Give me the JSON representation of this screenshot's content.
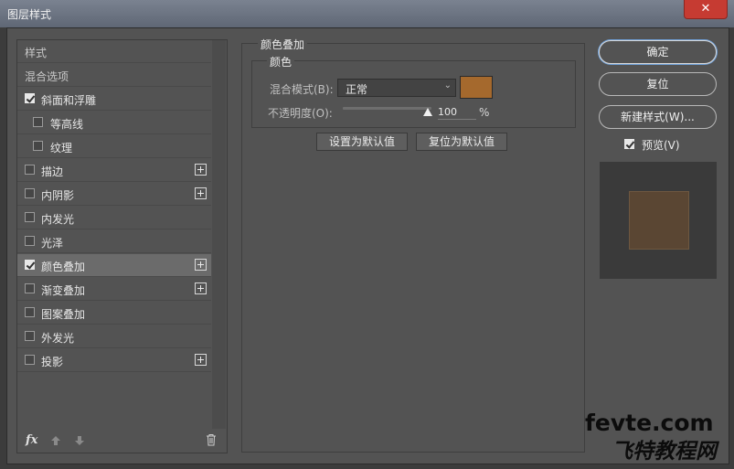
{
  "window": {
    "title": "图层样式",
    "close_glyph": "✕"
  },
  "styles_panel": {
    "header_styles": "样式",
    "header_blending": "混合选项",
    "items": [
      {
        "label": "斜面和浮雕",
        "checked": true,
        "indent": false,
        "has_add": false
      },
      {
        "label": "等高线",
        "checked": false,
        "indent": true,
        "has_add": false
      },
      {
        "label": "纹理",
        "checked": false,
        "indent": true,
        "has_add": false
      },
      {
        "label": "描边",
        "checked": false,
        "indent": false,
        "has_add": true
      },
      {
        "label": "内阴影",
        "checked": false,
        "indent": false,
        "has_add": true
      },
      {
        "label": "内发光",
        "checked": false,
        "indent": false,
        "has_add": false
      },
      {
        "label": "光泽",
        "checked": false,
        "indent": false,
        "has_add": false
      },
      {
        "label": "颜色叠加",
        "checked": true,
        "indent": false,
        "has_add": true,
        "selected": true
      },
      {
        "label": "渐变叠加",
        "checked": false,
        "indent": false,
        "has_add": true
      },
      {
        "label": "图案叠加",
        "checked": false,
        "indent": false,
        "has_add": false
      },
      {
        "label": "外发光",
        "checked": false,
        "indent": false,
        "has_add": false
      },
      {
        "label": "投影",
        "checked": false,
        "indent": false,
        "has_add": true
      }
    ],
    "fx_label": "fx"
  },
  "color_overlay": {
    "group_title": "颜色叠加",
    "sub_title": "颜色",
    "blend_mode_label": "混合模式(B):",
    "blend_mode_value": "正常",
    "overlay_color": "#a5692d",
    "opacity_label": "不透明度(O):",
    "opacity_value": "100",
    "opacity_unit": "%",
    "opacity_fraction": 1.0,
    "set_default_label": "设置为默认值",
    "reset_default_label": "复位为默认值"
  },
  "actions": {
    "ok_label": "确定",
    "reset_label": "复位",
    "new_style_label": "新建样式(W)...",
    "preview_label": "预览(V)",
    "preview_checked": true
  },
  "watermark": {
    "line1": "fevte.com",
    "line2": "飞特教程网"
  }
}
